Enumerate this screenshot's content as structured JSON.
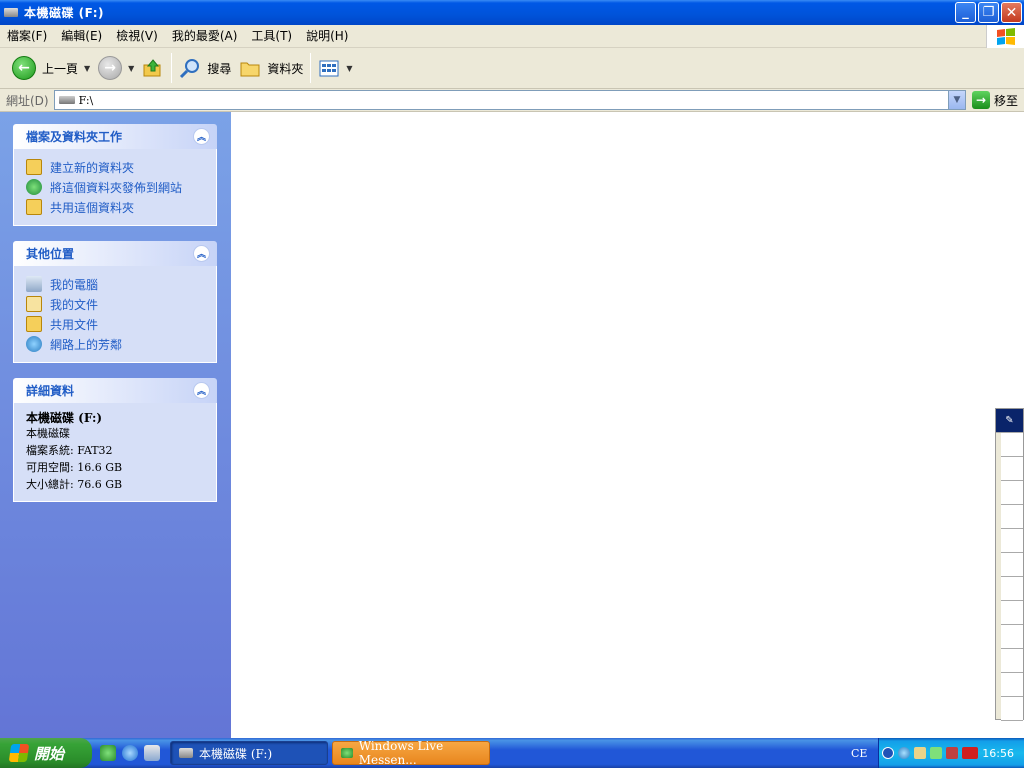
{
  "window": {
    "title": "本機磁碟 (F:)",
    "buttons": {
      "minimize": "_",
      "maximize": "❐",
      "close": "✕"
    }
  },
  "menu": {
    "items": [
      "檔案(F)",
      "編輯(E)",
      "檢視(V)",
      "我的最愛(A)",
      "工具(T)",
      "說明(H)"
    ]
  },
  "toolbar": {
    "back_label": "上一頁",
    "search_label": "搜尋",
    "folders_label": "資料夾"
  },
  "address": {
    "label": "網址(D)",
    "value": "F:\\",
    "go_label": "移至"
  },
  "taskpane": {
    "file_tasks": {
      "title": "檔案及資料夾工作",
      "items": [
        "建立新的資料夾",
        "將這個資料夾發佈到網站",
        "共用這個資料夾"
      ]
    },
    "other_places": {
      "title": "其他位置",
      "items": [
        "我的電腦",
        "我的文件",
        "共用文件",
        "網路上的芳鄰"
      ]
    },
    "details": {
      "title": "詳細資料",
      "name": "本機磁碟 (F:)",
      "type": "本機磁碟",
      "filesystem": "檔案系統: FAT32",
      "free": "可用空間: 16.6 GB",
      "total": "大小總計: 76.6 GB"
    }
  },
  "taskbar": {
    "start_label": "開始",
    "tasks": [
      "本機磁碟 (F:)",
      "Windows Live Messen..."
    ],
    "lang": "CE",
    "clock": "16:56"
  },
  "colors": {
    "titlebar": "#0058e6",
    "pane_link": "#215dc6",
    "taskbar": "#2157d7",
    "flash_task": "#f7a743"
  }
}
